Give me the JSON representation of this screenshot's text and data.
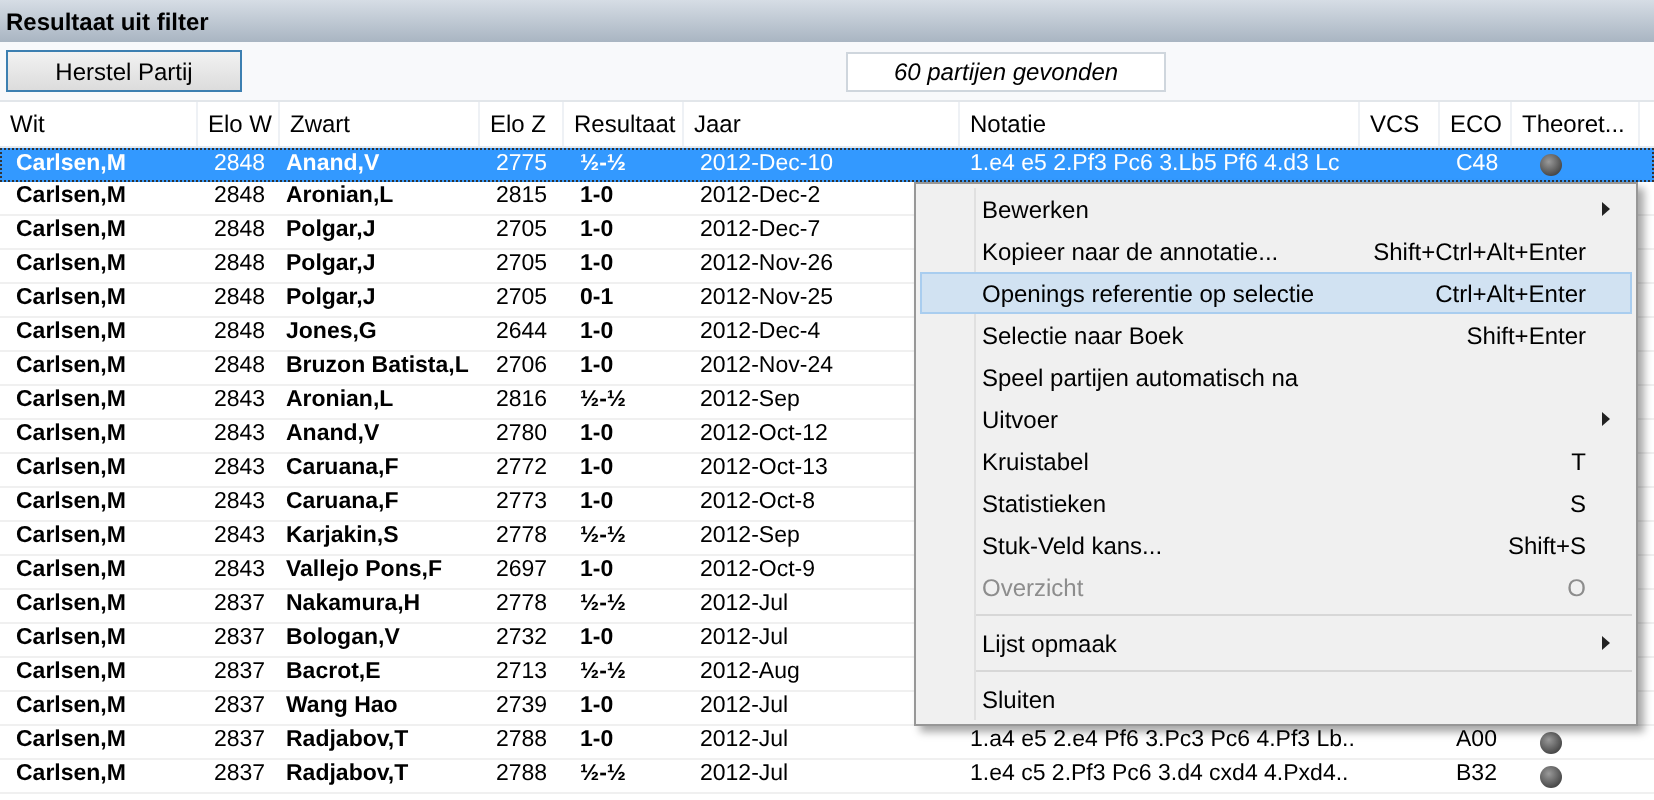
{
  "window": {
    "title": "Resultaat uit filter"
  },
  "toolbar": {
    "button": "Herstel Partij",
    "result_count": "60 partijen gevonden"
  },
  "table": {
    "columns": [
      "Wit",
      "Elo W",
      "Zwart",
      "Elo Z",
      "Resultaat",
      "Jaar",
      "Notatie",
      "VCS",
      "ECO",
      "Theoret..."
    ],
    "rows": [
      {
        "selected": true,
        "white": "Carlsen,M",
        "elo_w": "2848",
        "black": "Anand,V",
        "elo_z": "2775",
        "result": "½-½",
        "year": "2012-Dec-10",
        "notation": "1.e4 e5 2.Pf3 Pc6 3.Lb5 Pf6 4.d3 Lc",
        "eco": "C48"
      },
      {
        "selected": false,
        "white": "Carlsen,M",
        "elo_w": "2848",
        "black": "Aronian,L",
        "elo_z": "2815",
        "result": "1-0",
        "year": "2012-Dec-2"
      },
      {
        "selected": false,
        "white": "Carlsen,M",
        "elo_w": "2848",
        "black": "Polgar,J",
        "elo_z": "2705",
        "result": "1-0",
        "year": "2012-Dec-7"
      },
      {
        "selected": false,
        "white": "Carlsen,M",
        "elo_w": "2848",
        "black": "Polgar,J",
        "elo_z": "2705",
        "result": "1-0",
        "year": "2012-Nov-26"
      },
      {
        "selected": false,
        "white": "Carlsen,M",
        "elo_w": "2848",
        "black": "Polgar,J",
        "elo_z": "2705",
        "result": "0-1",
        "year": "2012-Nov-25"
      },
      {
        "selected": false,
        "white": "Carlsen,M",
        "elo_w": "2848",
        "black": "Jones,G",
        "elo_z": "2644",
        "result": "1-0",
        "year": "2012-Dec-4"
      },
      {
        "selected": false,
        "white": "Carlsen,M",
        "elo_w": "2848",
        "black": "Bruzon Batista,L",
        "elo_z": "2706",
        "result": "1-0",
        "year": "2012-Nov-24"
      },
      {
        "selected": false,
        "white": "Carlsen,M",
        "elo_w": "2843",
        "black": "Aronian,L",
        "elo_z": "2816",
        "result": "½-½",
        "year": "2012-Sep"
      },
      {
        "selected": false,
        "white": "Carlsen,M",
        "elo_w": "2843",
        "black": "Anand,V",
        "elo_z": "2780",
        "result": "1-0",
        "year": "2012-Oct-12"
      },
      {
        "selected": false,
        "white": "Carlsen,M",
        "elo_w": "2843",
        "black": "Caruana,F",
        "elo_z": "2772",
        "result": "1-0",
        "year": "2012-Oct-13"
      },
      {
        "selected": false,
        "white": "Carlsen,M",
        "elo_w": "2843",
        "black": "Caruana,F",
        "elo_z": "2773",
        "result": "1-0",
        "year": "2012-Oct-8"
      },
      {
        "selected": false,
        "white": "Carlsen,M",
        "elo_w": "2843",
        "black": "Karjakin,S",
        "elo_z": "2778",
        "result": "½-½",
        "year": "2012-Sep"
      },
      {
        "selected": false,
        "white": "Carlsen,M",
        "elo_w": "2843",
        "black": "Vallejo Pons,F",
        "elo_z": "2697",
        "result": "1-0",
        "year": "2012-Oct-9"
      },
      {
        "selected": false,
        "white": "Carlsen,M",
        "elo_w": "2837",
        "black": "Nakamura,H",
        "elo_z": "2778",
        "result": "½-½",
        "year": "2012-Jul"
      },
      {
        "selected": false,
        "white": "Carlsen,M",
        "elo_w": "2837",
        "black": "Bologan,V",
        "elo_z": "2732",
        "result": "1-0",
        "year": "2012-Jul"
      },
      {
        "selected": false,
        "white": "Carlsen,M",
        "elo_w": "2837",
        "black": "Bacrot,E",
        "elo_z": "2713",
        "result": "½-½",
        "year": "2012-Aug"
      },
      {
        "selected": false,
        "white": "Carlsen,M",
        "elo_w": "2837",
        "black": "Wang Hao",
        "elo_z": "2739",
        "result": "1-0",
        "year": "2012-Jul"
      },
      {
        "selected": false,
        "white": "Carlsen,M",
        "elo_w": "2837",
        "black": "Radjabov,T",
        "elo_z": "2788",
        "result": "1-0",
        "year": "2012-Jul",
        "notation": "1.a4 e5 2.e4 Pf6 3.Pc3 Pc6 4.Pf3 Lb..",
        "eco": "A00"
      },
      {
        "selected": false,
        "white": "Carlsen,M",
        "elo_w": "2837",
        "black": "Radjabov,T",
        "elo_z": "2788",
        "result": "½-½",
        "year": "2012-Jul",
        "notation": "1.e4 c5 2.Pf3 Pc6 3.d4 cxd4 4.Pxd4..",
        "eco": "B32"
      }
    ]
  },
  "context_menu": [
    {
      "kind": "item",
      "label": "Bewerken",
      "submenu": true,
      "selected": false,
      "disabled": false
    },
    {
      "kind": "item",
      "label": "Kopieer naar de annotatie...",
      "shortcut": "Shift+Ctrl+Alt+Enter",
      "submenu": false,
      "selected": false,
      "disabled": false
    },
    {
      "kind": "item",
      "label": "Openings referentie op selectie",
      "shortcut": "Ctrl+Alt+Enter",
      "submenu": false,
      "selected": true,
      "disabled": false
    },
    {
      "kind": "item",
      "label": "Selectie naar Boek",
      "shortcut": "Shift+Enter",
      "submenu": false,
      "selected": false,
      "disabled": false
    },
    {
      "kind": "item",
      "label": "Speel partijen automatisch na",
      "submenu": false,
      "selected": false,
      "disabled": false
    },
    {
      "kind": "item",
      "label": "Uitvoer",
      "submenu": true,
      "selected": false,
      "disabled": false
    },
    {
      "kind": "item",
      "label": "Kruistabel",
      "shortcut": "T",
      "submenu": false,
      "selected": false,
      "disabled": false
    },
    {
      "kind": "item",
      "label": "Statistieken",
      "shortcut": "S",
      "submenu": false,
      "selected": false,
      "disabled": false
    },
    {
      "kind": "item",
      "label": "Stuk-Veld kans...",
      "shortcut": "Shift+S",
      "submenu": false,
      "selected": false,
      "disabled": false
    },
    {
      "kind": "item",
      "label": "Overzicht",
      "shortcut": "O",
      "submenu": false,
      "selected": false,
      "disabled": true
    },
    {
      "kind": "separator"
    },
    {
      "kind": "item",
      "label": "Lijst opmaak",
      "submenu": true,
      "selected": false,
      "disabled": false
    },
    {
      "kind": "separator"
    },
    {
      "kind": "item",
      "label": "Sluiten",
      "submenu": false,
      "selected": false,
      "disabled": false
    }
  ]
}
